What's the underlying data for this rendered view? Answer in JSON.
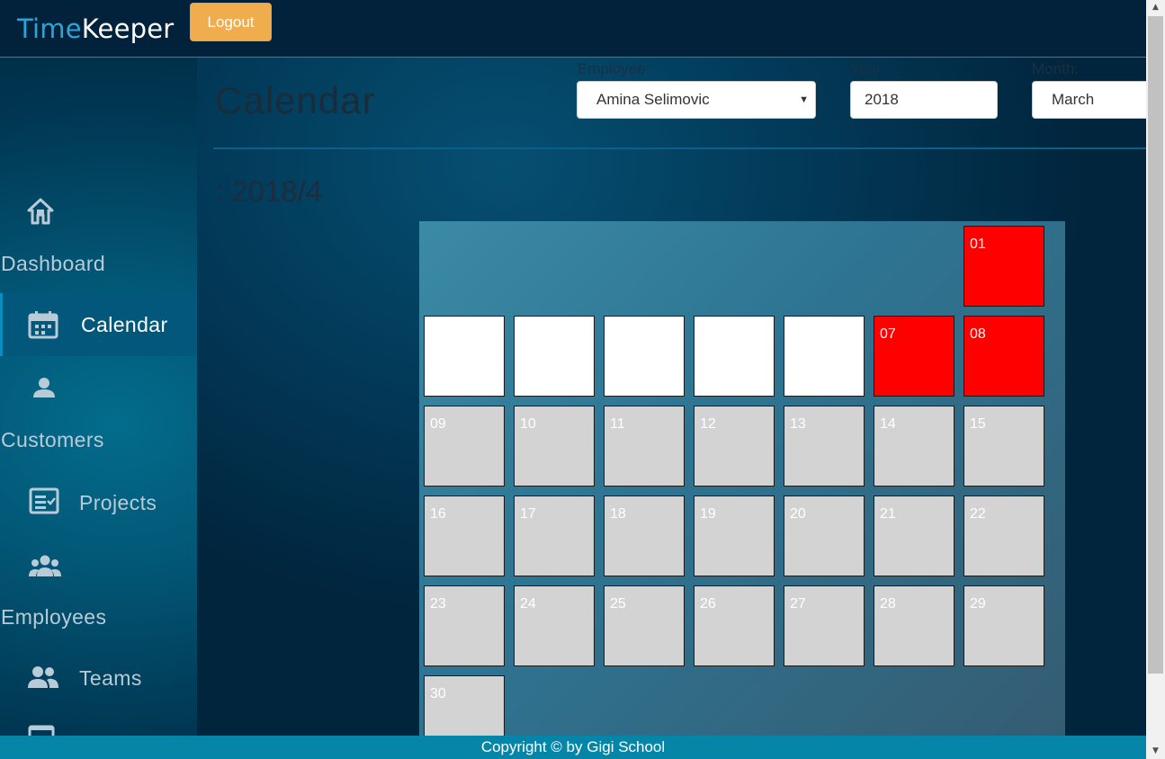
{
  "header": {
    "brand_part1": "Time",
    "brand_part2": "Keeper",
    "logout_label": "Logout"
  },
  "sidebar": {
    "items": [
      {
        "label": "Dashboard",
        "icon": "home-icon"
      },
      {
        "label": "Calendar",
        "icon": "calendar-icon",
        "active": true
      },
      {
        "label": "Customers",
        "icon": "user-icon"
      },
      {
        "label": "Projects",
        "icon": "checklist-icon"
      },
      {
        "label": "Employees",
        "icon": "group-icon"
      },
      {
        "label": "Teams",
        "icon": "team-icon"
      },
      {
        "label": "",
        "icon": "document-icon"
      }
    ]
  },
  "main": {
    "title": "Calendar",
    "subtitle": ": 2018/4",
    "filters": {
      "employee_label": "Employee:",
      "employee_value": "Amina Selimovic",
      "year_label": "Year:",
      "year_value": "2018",
      "month_label": "Month:",
      "month_value": "March"
    }
  },
  "calendar": {
    "days": [
      {
        "label": "01",
        "status": "red"
      },
      {
        "label": "",
        "status": "white"
      },
      {
        "label": "",
        "status": "white"
      },
      {
        "label": "",
        "status": "white"
      },
      {
        "label": "",
        "status": "white"
      },
      {
        "label": "",
        "status": "white"
      },
      {
        "label": "07",
        "status": "red"
      },
      {
        "label": "08",
        "status": "red"
      },
      {
        "label": "09",
        "status": "grey"
      },
      {
        "label": "10",
        "status": "grey"
      },
      {
        "label": "11",
        "status": "grey"
      },
      {
        "label": "12",
        "status": "grey"
      },
      {
        "label": "13",
        "status": "grey"
      },
      {
        "label": "14",
        "status": "grey"
      },
      {
        "label": "15",
        "status": "grey"
      },
      {
        "label": "16",
        "status": "grey"
      },
      {
        "label": "17",
        "status": "grey"
      },
      {
        "label": "18",
        "status": "grey"
      },
      {
        "label": "19",
        "status": "grey"
      },
      {
        "label": "20",
        "status": "grey"
      },
      {
        "label": "21",
        "status": "grey"
      },
      {
        "label": "22",
        "status": "grey"
      },
      {
        "label": "23",
        "status": "grey"
      },
      {
        "label": "24",
        "status": "grey"
      },
      {
        "label": "25",
        "status": "grey"
      },
      {
        "label": "26",
        "status": "grey"
      },
      {
        "label": "27",
        "status": "grey"
      },
      {
        "label": "28",
        "status": "grey"
      },
      {
        "label": "29",
        "status": "grey"
      },
      {
        "label": "30",
        "status": "grey"
      }
    ]
  },
  "footer": {
    "text": "Copyright © by Gigi School"
  },
  "colors": {
    "red_day": "#ff0000",
    "grey_day": "#d3d3d3",
    "white_day": "#ffffff",
    "logout": "#f0ad4e",
    "footer": "#0585a7"
  }
}
